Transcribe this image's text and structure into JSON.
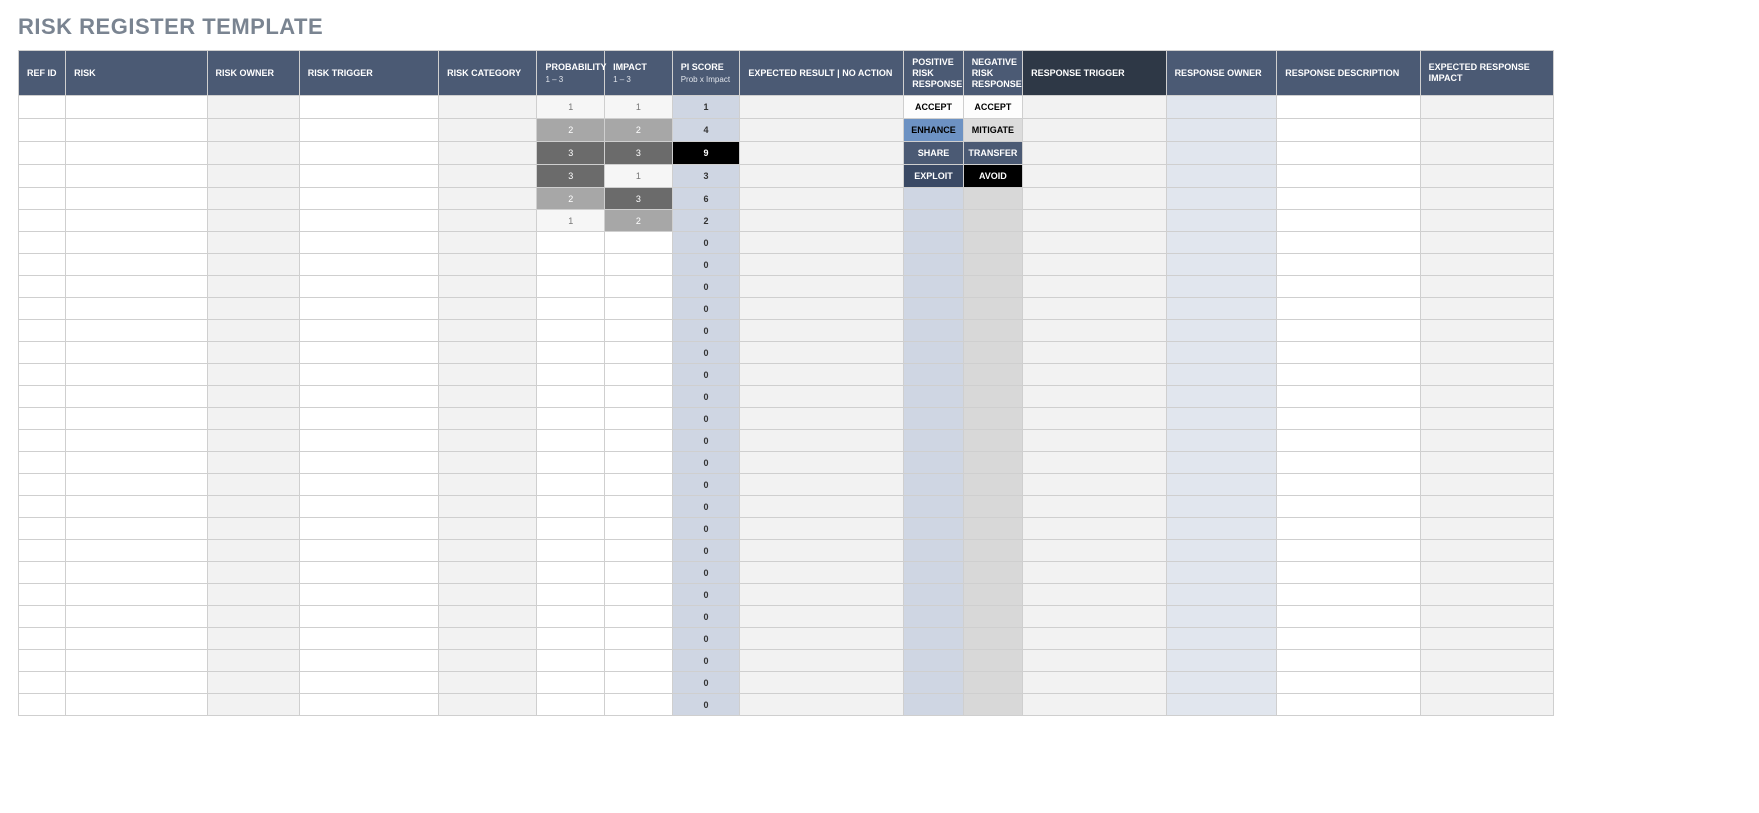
{
  "title": "RISK REGISTER TEMPLATE",
  "headers": {
    "ref_id": "REF ID",
    "risk": "RISK",
    "risk_owner": "RISK OWNER",
    "risk_trigger": "RISK TRIGGER",
    "risk_category": "RISK CATEGORY",
    "probability": "PROBABILITY",
    "probability_sub": "1 – 3",
    "impact": "IMPACT",
    "impact_sub": "1 – 3",
    "pi_score": "PI SCORE",
    "pi_score_sub": "Prob x Impact",
    "expected_result": "EXPECTED RESULT  |  NO ACTION",
    "positive_response": "POSITIVE RISK RESPONSE",
    "negative_response": "NEGATIVE RISK RESPONSE",
    "response_trigger": "RESPONSE TRIGGER",
    "response_owner": "RESPONSE OWNER",
    "response_description": "RESPONSE DESCRIPTION",
    "expected_response_impact": "EXPECTED RESPONSE IMPACT"
  },
  "rows": [
    {
      "probability": "1",
      "impact": "1",
      "pi": "1",
      "pos": "ACCEPT",
      "neg": "ACCEPT"
    },
    {
      "probability": "2",
      "impact": "2",
      "pi": "4",
      "pos": "ENHANCE",
      "neg": "MITIGATE"
    },
    {
      "probability": "3",
      "impact": "3",
      "pi": "9",
      "pos": "SHARE",
      "neg": "TRANSFER"
    },
    {
      "probability": "3",
      "impact": "1",
      "pi": "3",
      "pos": "EXPLOIT",
      "neg": "AVOID"
    },
    {
      "probability": "2",
      "impact": "3",
      "pi": "6",
      "pos": "",
      "neg": ""
    },
    {
      "probability": "1",
      "impact": "2",
      "pi": "2",
      "pos": "",
      "neg": ""
    },
    {
      "probability": "",
      "impact": "",
      "pi": "0",
      "pos": "",
      "neg": ""
    },
    {
      "probability": "",
      "impact": "",
      "pi": "0",
      "pos": "",
      "neg": ""
    },
    {
      "probability": "",
      "impact": "",
      "pi": "0",
      "pos": "",
      "neg": ""
    },
    {
      "probability": "",
      "impact": "",
      "pi": "0",
      "pos": "",
      "neg": ""
    },
    {
      "probability": "",
      "impact": "",
      "pi": "0",
      "pos": "",
      "neg": ""
    },
    {
      "probability": "",
      "impact": "",
      "pi": "0",
      "pos": "",
      "neg": ""
    },
    {
      "probability": "",
      "impact": "",
      "pi": "0",
      "pos": "",
      "neg": ""
    },
    {
      "probability": "",
      "impact": "",
      "pi": "0",
      "pos": "",
      "neg": ""
    },
    {
      "probability": "",
      "impact": "",
      "pi": "0",
      "pos": "",
      "neg": ""
    },
    {
      "probability": "",
      "impact": "",
      "pi": "0",
      "pos": "",
      "neg": ""
    },
    {
      "probability": "",
      "impact": "",
      "pi": "0",
      "pos": "",
      "neg": ""
    },
    {
      "probability": "",
      "impact": "",
      "pi": "0",
      "pos": "",
      "neg": ""
    },
    {
      "probability": "",
      "impact": "",
      "pi": "0",
      "pos": "",
      "neg": ""
    },
    {
      "probability": "",
      "impact": "",
      "pi": "0",
      "pos": "",
      "neg": ""
    },
    {
      "probability": "",
      "impact": "",
      "pi": "0",
      "pos": "",
      "neg": ""
    },
    {
      "probability": "",
      "impact": "",
      "pi": "0",
      "pos": "",
      "neg": ""
    },
    {
      "probability": "",
      "impact": "",
      "pi": "0",
      "pos": "",
      "neg": ""
    },
    {
      "probability": "",
      "impact": "",
      "pi": "0",
      "pos": "",
      "neg": ""
    },
    {
      "probability": "",
      "impact": "",
      "pi": "0",
      "pos": "",
      "neg": ""
    },
    {
      "probability": "",
      "impact": "",
      "pi": "0",
      "pos": "",
      "neg": ""
    },
    {
      "probability": "",
      "impact": "",
      "pi": "0",
      "pos": "",
      "neg": ""
    },
    {
      "probability": "",
      "impact": "",
      "pi": "0",
      "pos": "",
      "neg": ""
    }
  ],
  "col_widths": {
    "ref_id": 46,
    "risk": 138,
    "risk_owner": 90,
    "risk_trigger": 136,
    "risk_category": 96,
    "probability": 66,
    "impact": 66,
    "pi_score": 66,
    "expected_result": 160,
    "positive_response": 58,
    "negative_response": 58,
    "response_trigger": 140,
    "response_owner": 108,
    "response_description": 140,
    "expected_response_impact": 130
  }
}
